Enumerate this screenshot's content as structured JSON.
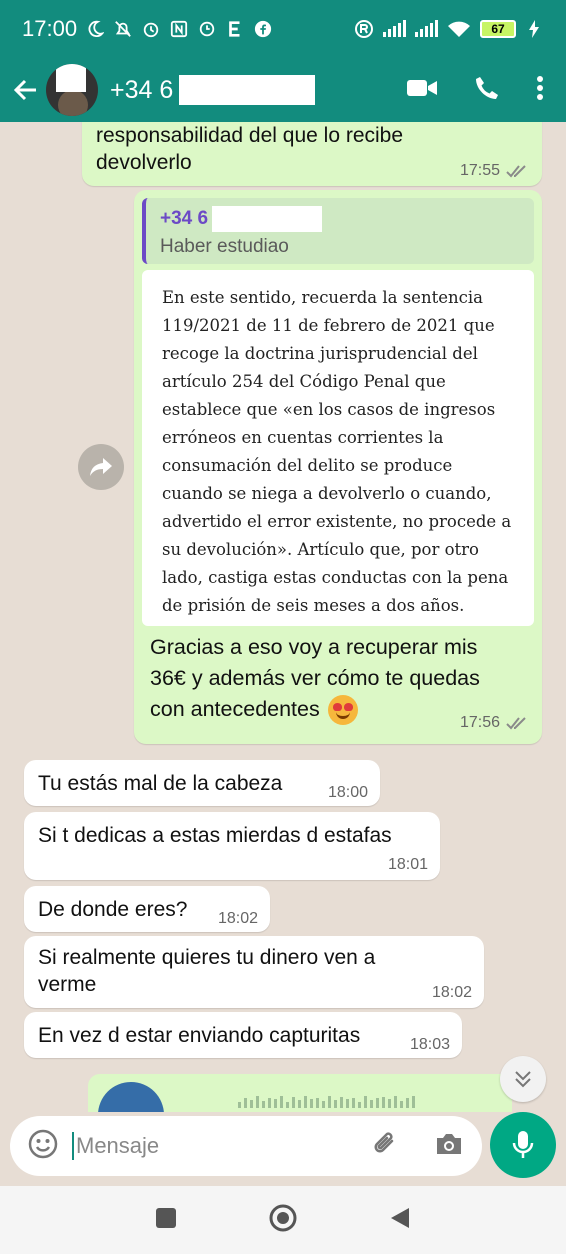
{
  "status_bar": {
    "time": "17:00",
    "battery": "67"
  },
  "header": {
    "contact": "+34 6"
  },
  "messages": [
    {
      "dir": "out",
      "text_line1": "responsabilidad del que lo recibe",
      "text_line2": "devolverlo",
      "time": "17:55"
    },
    {
      "dir": "out",
      "quote_name": "+34 6",
      "quote_text": "Haber estudiao",
      "doc_lines": [
        "En este sentido, recuerda la sentencia",
        "119/2021 de 11 de febrero de 2021 que",
        "recoge la doctrina jurisprudencial del",
        "artículo 254 del Código Penal que",
        "establece que «en los casos de ingresos",
        "erróneos en cuentas corrientes la",
        "consumación del delito se produce",
        "cuando se niega a devolverlo o cuando,",
        "advertido el error existente, no procede a",
        "su devolución». Artículo que, por otro",
        "lado, castiga estas conductas con la pena",
        "de prisión de seis meses a dos años."
      ],
      "text_line1": "Gracias a eso voy a recuperar mis",
      "text_line2": "36€ y además ver cómo te quedas",
      "text_line3": "con antecedentes",
      "time": "17:56"
    },
    {
      "dir": "in",
      "text": "Tu estás mal de la cabeza",
      "time": "18:00"
    },
    {
      "dir": "in",
      "text": "Si t dedicas a estas mierdas d estafas",
      "time": "18:01"
    },
    {
      "dir": "in",
      "text": "De donde eres?",
      "time": "18:02"
    },
    {
      "dir": "in",
      "text_line1": "Si realmente quieres tu dinero ven a",
      "text_line2": "verme",
      "time": "18:02"
    },
    {
      "dir": "in",
      "text": "En vez d estar enviando capturitas",
      "time": "18:03"
    }
  ],
  "input": {
    "placeholder": "Mensaje"
  },
  "colors": {
    "header": "#128c7e",
    "chat_bg": "#e7ddd4",
    "outgoing": "#dcf8c6",
    "incoming": "#ffffff",
    "accent": "#00a884",
    "quote_name": "#6c4ac6"
  },
  "icons": {
    "header": [
      "back-arrow-icon",
      "video-call-icon",
      "phone-icon",
      "more-vert-icon"
    ],
    "input": [
      "emoji-icon",
      "attach-icon",
      "camera-icon",
      "mic-icon"
    ],
    "nav": [
      "recents-icon",
      "home-icon",
      "back-nav-icon"
    ]
  }
}
